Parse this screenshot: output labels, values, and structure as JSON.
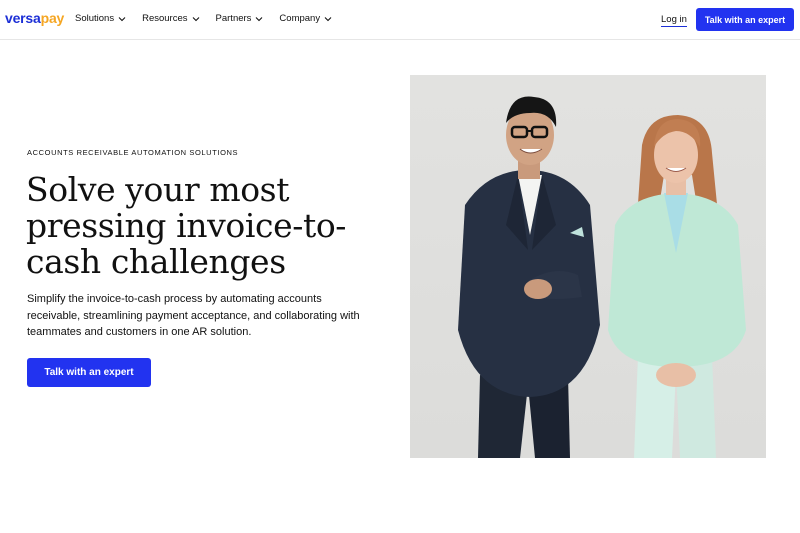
{
  "nav": {
    "logo_text": "versapay",
    "menu": [
      {
        "label": "Solutions"
      },
      {
        "label": "Resources"
      },
      {
        "label": "Partners"
      },
      {
        "label": "Company"
      }
    ],
    "login_label": "Log in",
    "cta_label": "Talk with an expert"
  },
  "hero": {
    "eyebrow": "ACCOUNTS RECEIVABLE AUTOMATION SOLUTIONS",
    "headline": "Solve your most pressing invoice-to-cash challenges",
    "subtext": "Simplify the invoice-to-cash process by automating accounts receivable, streamlining payment acceptance, and collaborating with teammates and customers in one AR solution.",
    "cta_label": "Talk with an expert"
  },
  "colors": {
    "brand_blue": "#2233f0",
    "logo_accent": "#f5a623"
  },
  "icons": {
    "menu_chevron": "chevron-down-icon"
  }
}
